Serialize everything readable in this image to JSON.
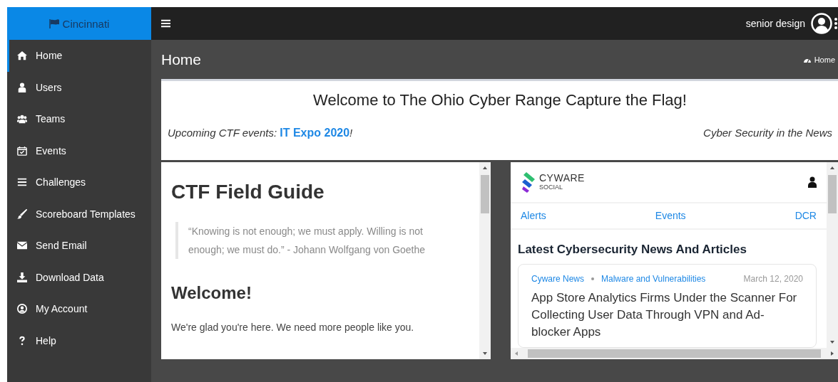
{
  "brand": {
    "label": "Cincinnati"
  },
  "topbar": {
    "username": "senior design"
  },
  "sidebar": {
    "items": [
      {
        "label": "Home",
        "selected": true
      },
      {
        "label": "Users",
        "selected": false
      },
      {
        "label": "Teams",
        "selected": false
      },
      {
        "label": "Events",
        "selected": false
      },
      {
        "label": "Challenges",
        "selected": false
      },
      {
        "label": "Scoreboard Templates",
        "selected": false
      },
      {
        "label": "Send Email",
        "selected": false
      },
      {
        "label": "Download Data",
        "selected": false
      },
      {
        "label": "My Account",
        "selected": false
      },
      {
        "label": "Help",
        "selected": false
      }
    ]
  },
  "page": {
    "title": "Home",
    "breadcrumb": "Home"
  },
  "welcome": {
    "title": "Welcome to The Ohio Cyber Range Capture the Flag!",
    "upcoming_prefix": "Upcoming CTF events: ",
    "upcoming_link": "IT Expo 2020",
    "upcoming_suffix": "!",
    "news_label": "Cyber Security in the News"
  },
  "field_guide": {
    "title": "CTF Field Guide",
    "quote": "“Knowing is not enough; we must apply. Willing is not enough; we must do.” - Johann Wolfgang von Goethe",
    "heading": "Welcome!",
    "text": "We're glad you're here. We need more people like you."
  },
  "news_widget": {
    "logo_name": "CYWARE",
    "logo_sub": "SOCIAL",
    "nav": [
      "Alerts",
      "Events",
      "DCR"
    ],
    "heading": "Latest Cybersecurity News And Articles",
    "article": {
      "source": "Cyware News",
      "category": "Malware and Vulnerabilities",
      "date": "March 12, 2020",
      "title": "App Store Analytics Firms Under the Scanner For Collecting User Data Through VPN and Ad-blocker Apps"
    }
  }
}
